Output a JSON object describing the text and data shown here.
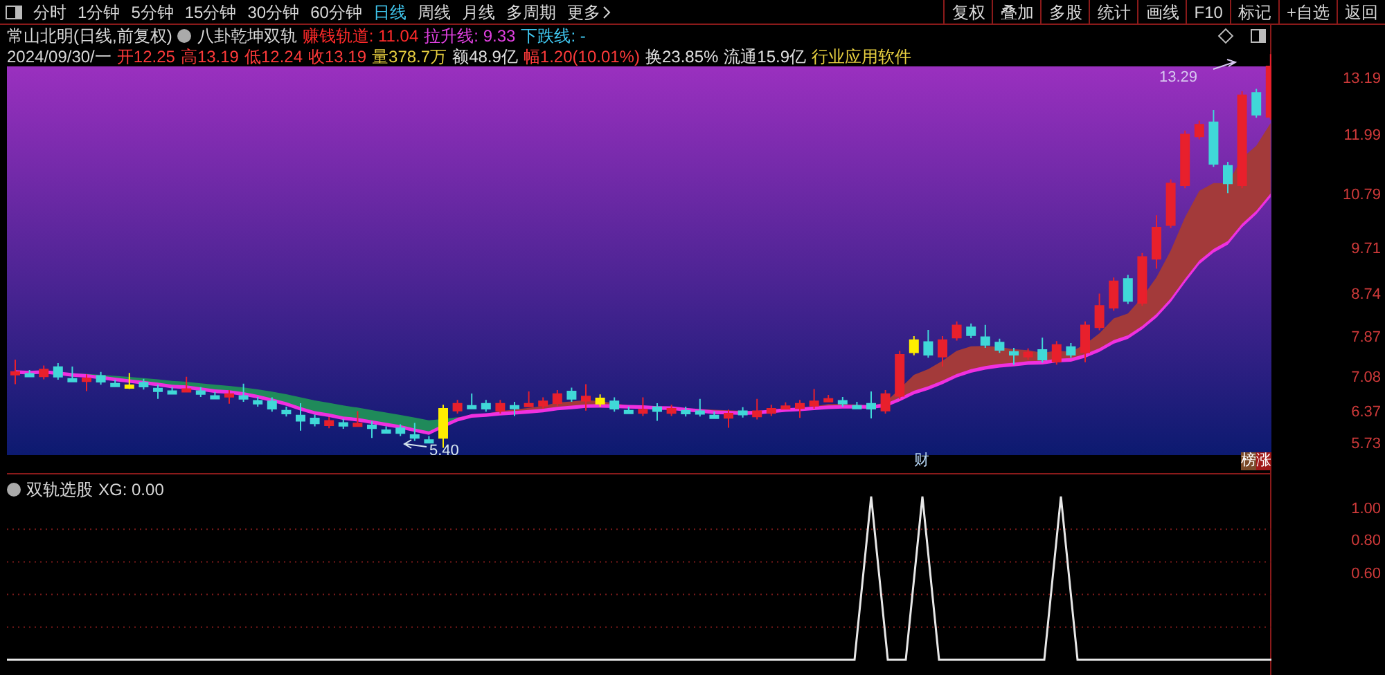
{
  "toolbar": {
    "period_tabs": [
      {
        "label": "分时",
        "selected": false
      },
      {
        "label": "1分钟",
        "selected": false
      },
      {
        "label": "5分钟",
        "selected": false
      },
      {
        "label": "15分钟",
        "selected": false
      },
      {
        "label": "30分钟",
        "selected": false
      },
      {
        "label": "60分钟",
        "selected": false
      },
      {
        "label": "日线",
        "selected": true
      },
      {
        "label": "周线",
        "selected": false
      },
      {
        "label": "月线",
        "selected": false
      },
      {
        "label": "多周期",
        "selected": false
      }
    ],
    "more": "更多",
    "actions": [
      "复权",
      "叠加",
      "多股",
      "统计",
      "画线",
      "F10",
      "标记",
      "+自选",
      "返回"
    ]
  },
  "quote": {
    "title": "常山北明(日线,前复权)",
    "indicator": "八卦乾坤双轨",
    "lines": [
      {
        "label": "赚钱轨道:",
        "value": "11.04",
        "color": "#ff2a2a"
      },
      {
        "label": "拉升线:",
        "value": "9.33",
        "color": "#e040e0"
      },
      {
        "label": "下跌线:",
        "value": "-",
        "color": "#40c8f0"
      }
    ],
    "date": "2024/09/30/一",
    "fields": [
      {
        "text": "开12.25",
        "color": "#ff3a3a"
      },
      {
        "text": "高13.19",
        "color": "#ff3a3a"
      },
      {
        "text": "低12.24",
        "color": "#ff3a3a"
      },
      {
        "text": "收13.19",
        "color": "#ff3a3a"
      },
      {
        "text": "量378.7万",
        "color": "#e8d040"
      },
      {
        "text": "额48.9亿",
        "color": "#e0e0e0"
      },
      {
        "text": "幅1.20(10.01%)",
        "color": "#ff3a3a"
      },
      {
        "text": "换23.85%",
        "color": "#e0e0e0"
      },
      {
        "text": "流通15.9亿",
        "color": "#e0e0e0"
      },
      {
        "text": "行业应用软件",
        "color": "#e8d040"
      }
    ]
  },
  "main_chart": {
    "high_label": "13.29",
    "low_label": "5.40",
    "price_axis": [
      "13.19",
      "11.99",
      "10.79",
      "9.71",
      "8.74",
      "7.87",
      "7.08",
      "6.37",
      "5.73"
    ],
    "markers": [
      "财",
      "榜",
      "涨"
    ]
  },
  "sub_chart": {
    "title": "双轨选股",
    "value": "XG: 0.00",
    "axis": [
      "1.00",
      "0.80",
      "0.60"
    ]
  }
}
